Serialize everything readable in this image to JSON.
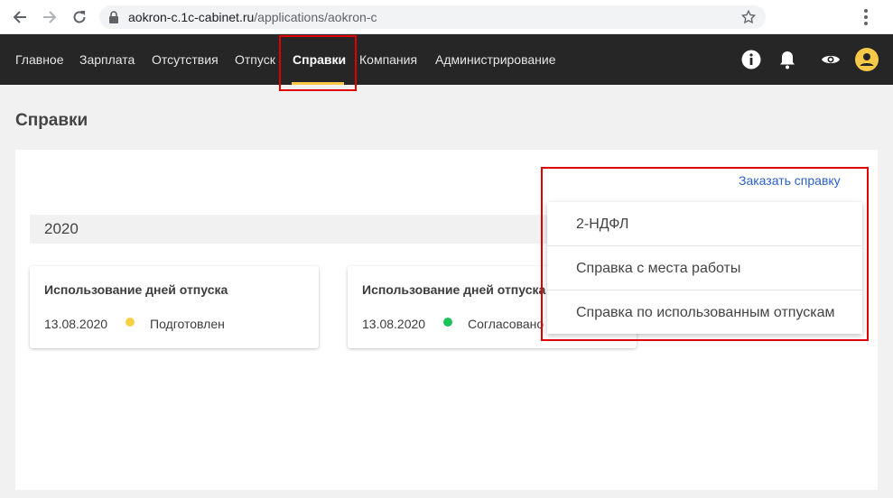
{
  "browser": {
    "url_host": "aokron-c.1c-cabinet.ru",
    "url_path": "/applications/aokron-c"
  },
  "menu": {
    "items": [
      {
        "label": "Главное"
      },
      {
        "label": "Зарплата"
      },
      {
        "label": "Отсутствия"
      },
      {
        "label": "Отпуск"
      },
      {
        "label": "Справки",
        "active": true
      },
      {
        "label": "Компания"
      },
      {
        "label": "Администрирование"
      }
    ]
  },
  "page": {
    "title": "Справки",
    "order_link": "Заказать справку",
    "year": "2020"
  },
  "cards": [
    {
      "title": "Использование дней отпуска",
      "date": "13.08.2020",
      "status": "Подготовлен",
      "status_color": "#f5d142"
    },
    {
      "title": "Использование дней отпуска",
      "date": "13.08.2020",
      "status": "Согласовано",
      "status_color": "#1ec25a"
    }
  ],
  "dropdown": {
    "items": [
      {
        "label": "2-НДФЛ"
      },
      {
        "label": "Справка с места работы"
      },
      {
        "label": "Справка по использованным отпускам"
      }
    ]
  },
  "colors": {
    "header_bg": "#262626",
    "accent": "#f7c948",
    "link": "#2b61c9",
    "highlight": "#e00000"
  }
}
